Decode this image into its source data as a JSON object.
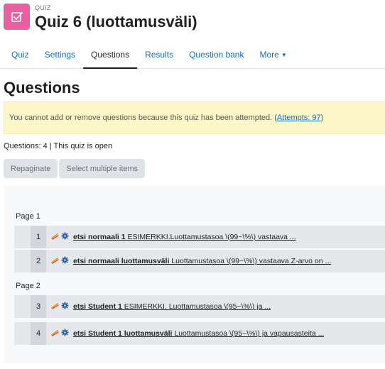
{
  "header": {
    "activity_type": "QUIZ",
    "title": "Quiz 6 (luottamusväli)"
  },
  "tabs": [
    {
      "label": "Quiz",
      "active": false
    },
    {
      "label": "Settings",
      "active": false
    },
    {
      "label": "Questions",
      "active": true
    },
    {
      "label": "Results",
      "active": false
    },
    {
      "label": "Question bank",
      "active": false
    },
    {
      "label": "More",
      "active": false
    }
  ],
  "section_heading": "Questions",
  "alert": {
    "text": "You cannot add or remove questions because this quiz has been attempted. (",
    "link": "Attempts: 97",
    "suffix": ")"
  },
  "status_line": "Questions: 4 | This quiz is open",
  "buttons": {
    "repaginate": "Repaginate",
    "select_multiple": "Select multiple items"
  },
  "pages": [
    {
      "label": "Page 1",
      "questions": [
        {
          "number": "1",
          "name": "etsi normaali 1",
          "preview": "ESIMERKKI.Luottamustasoa \\(99~\\%\\) vastaava ..."
        },
        {
          "number": "2",
          "name": "etsi normaali luottamusväli",
          "preview": "Luottamustasoa \\(99~\\%\\) vastaava Z-arvo on ..."
        }
      ]
    },
    {
      "label": "Page 2",
      "questions": [
        {
          "number": "3",
          "name": "etsi Student 1",
          "preview": "ESIMERKKI. Luottamustasoa \\(95~\\%\\) ja ..."
        },
        {
          "number": "4",
          "name": "etsi Student 1 luottamusväli",
          "preview": "Luottamustasoa \\(95~\\%\\) ja vapausasteita ..."
        }
      ]
    }
  ],
  "colors": {
    "quiz_icon_bg": "#e8609f",
    "link": "#0f6cbf",
    "alert_bg": "#fdf6c7"
  },
  "icons": {
    "activity": "quiz-icon",
    "question_type": "calculated-question-icon",
    "question_settings": "gear-icon"
  }
}
